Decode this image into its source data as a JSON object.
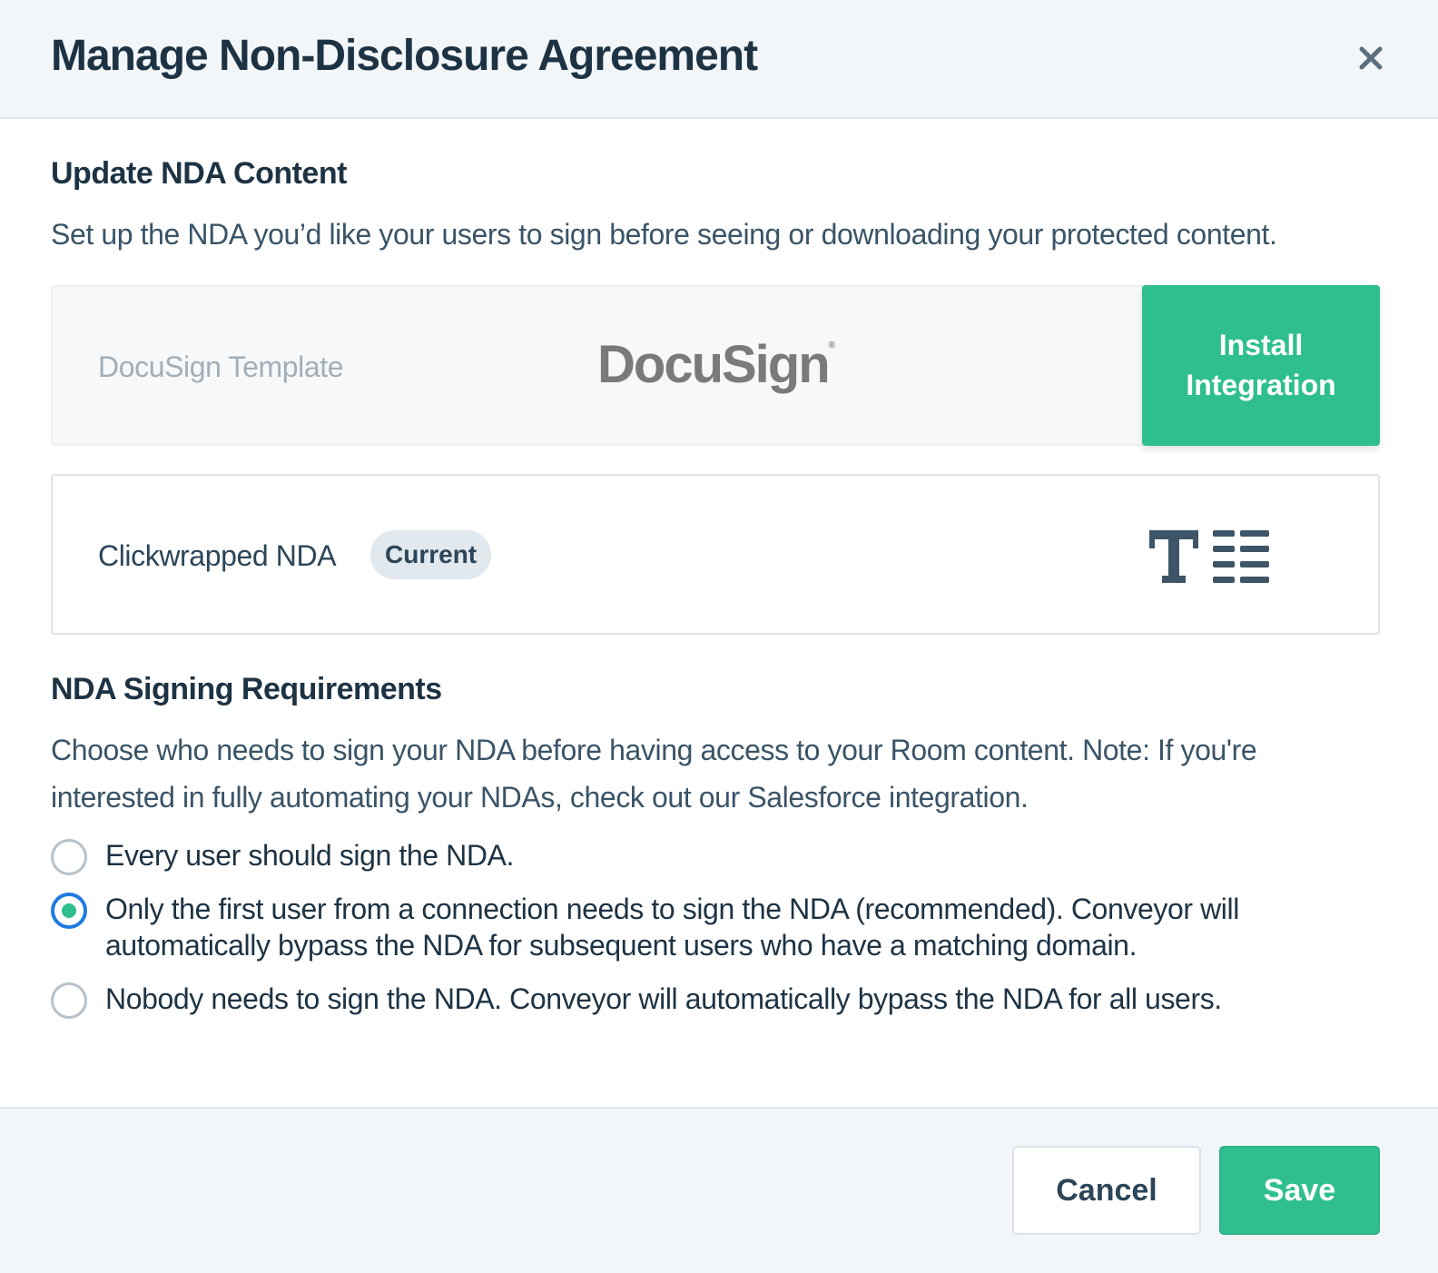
{
  "modal": {
    "title": "Manage Non-Disclosure Agreement",
    "close_icon": "close-icon"
  },
  "content_section": {
    "heading": "Update NDA Content",
    "description": "Set up the NDA you’d like your users to sign before seeing or downloading your protected content.",
    "options": [
      {
        "label": "DocuSign Template",
        "logo_text": "DocuSign",
        "action_label_line1": "Install",
        "action_label_line2": "Integration"
      },
      {
        "label": "Clickwrapped NDA",
        "badge": "Current",
        "icon": "text-document-icon"
      }
    ]
  },
  "requirements_section": {
    "heading": "NDA Signing Requirements",
    "description": "Choose who needs to sign your NDA before having access to your Room content. Note: If you're interested in fully automating your NDAs, check out our Salesforce integration.",
    "selected_index": 1,
    "options": [
      {
        "label": "Every user should sign the NDA."
      },
      {
        "label": "Only the first user from a connection needs to sign the NDA (recommended). Conveyor will automatically bypass the NDA for subsequent users who have a matching domain."
      },
      {
        "label": "Nobody needs to sign the NDA. Conveyor will automatically bypass the NDA for all users."
      }
    ]
  },
  "footer": {
    "cancel_label": "Cancel",
    "save_label": "Save"
  },
  "colors": {
    "accent": "#2fbf8f",
    "radio_focus": "#1f7be0",
    "text_dark": "#1d3344",
    "header_bg": "#f3f6f9"
  }
}
